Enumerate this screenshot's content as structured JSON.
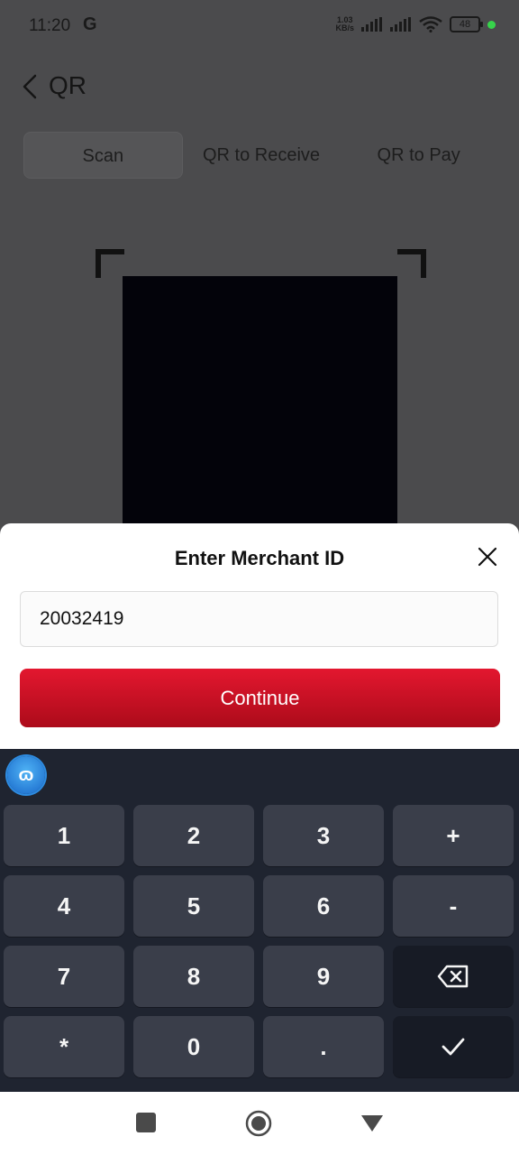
{
  "status_bar": {
    "time": "11:20",
    "g_icon": "G",
    "net_speed_value": "1.03",
    "net_speed_unit": "KB/s",
    "battery": "48"
  },
  "header": {
    "title": "QR",
    "back_icon": "chevron-left-icon"
  },
  "tabs": [
    {
      "label": "Scan",
      "active": true
    },
    {
      "label": "QR to Receive",
      "active": false
    },
    {
      "label": "QR to Pay",
      "active": false
    }
  ],
  "dialog": {
    "title": "Enter Merchant ID",
    "merchant_id_value": "20032419",
    "continue_label": "Continue",
    "close_icon": "close-icon"
  },
  "keyboard": {
    "keys": [
      "1",
      "2",
      "3",
      "+",
      "4",
      "5",
      "6",
      "-",
      "7",
      "8",
      "9",
      "backspace",
      "*",
      "0",
      ".",
      "done"
    ],
    "backspace_icon": "backspace-icon",
    "done_icon": "checkmark-icon",
    "logo_icon": "keyboard-logo-icon"
  },
  "nav_bar": {
    "buttons": [
      "square-icon",
      "circle-icon",
      "triangle-down-icon"
    ]
  },
  "colors": {
    "accent": "#e3172f",
    "overlay": "#4b4b4d",
    "keyboard_bg": "#1f2430",
    "key_bg": "#3a3e4a"
  }
}
